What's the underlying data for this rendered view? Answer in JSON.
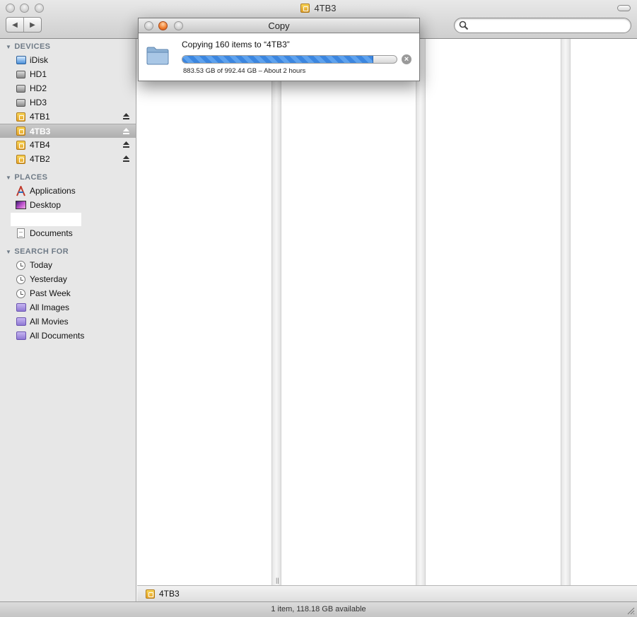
{
  "window": {
    "title": "4TB3",
    "search": {
      "placeholder": "",
      "value": ""
    },
    "nav": {
      "back": "◀",
      "forward": "▶"
    }
  },
  "sidebar": {
    "devices_heading": "DEVICES",
    "devices": [
      {
        "label": "iDisk",
        "icon": "idisk-icon",
        "eject": false
      },
      {
        "label": "HD1",
        "icon": "hard-drive-icon",
        "eject": false
      },
      {
        "label": "HD2",
        "icon": "hard-drive-icon",
        "eject": false
      },
      {
        "label": "HD3",
        "icon": "hard-drive-icon",
        "eject": false
      },
      {
        "label": "4TB1",
        "icon": "external-volume-icon",
        "eject": true
      },
      {
        "label": "4TB3",
        "icon": "external-volume-icon",
        "eject": true,
        "selected": true
      },
      {
        "label": "4TB4",
        "icon": "external-volume-icon",
        "eject": true
      },
      {
        "label": "4TB2",
        "icon": "external-volume-icon",
        "eject": true
      }
    ],
    "places_heading": "PLACES",
    "places": [
      {
        "label": "Applications",
        "icon": "applications-icon"
      },
      {
        "label": "Desktop",
        "icon": "desktop-icon"
      },
      {
        "label": "Documents",
        "icon": "documents-icon"
      }
    ],
    "search_heading": "SEARCH FOR",
    "searches": [
      {
        "label": "Today",
        "icon": "clock-icon"
      },
      {
        "label": "Yesterday",
        "icon": "clock-icon"
      },
      {
        "label": "Past Week",
        "icon": "clock-icon"
      },
      {
        "label": "All Images",
        "icon": "smart-folder-icon"
      },
      {
        "label": "All Movies",
        "icon": "smart-folder-icon"
      },
      {
        "label": "All Documents",
        "icon": "smart-folder-icon"
      }
    ]
  },
  "pathbar": {
    "label": "4TB3"
  },
  "status": {
    "text": "1 item, 118.18 GB available"
  },
  "copy_dialog": {
    "title": "Copy",
    "message": "Copying 160 items to “4TB3”",
    "detail": "883.53 GB of 992.44 GB – About 2 hours",
    "progress": 0.89,
    "cancel_glyph": "×"
  },
  "colors": {
    "selection": "#b4b4b4",
    "progress": "#3c86df",
    "section_heading": "#6f7b87",
    "volume": "#f0b93a"
  }
}
